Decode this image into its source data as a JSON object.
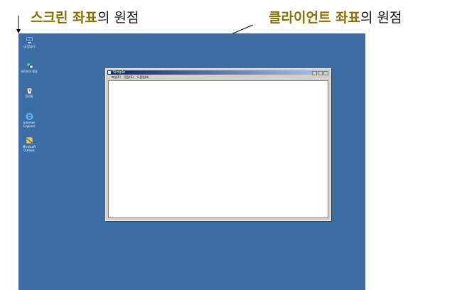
{
  "annotations": {
    "screen_origin": {
      "highlight": "스크린 좌표",
      "suffix": "의 원점"
    },
    "client_origin": {
      "highlight": "클라이언트 좌표",
      "suffix": "의 원점"
    }
  },
  "desktop": {
    "background_color": "#3a6ea5",
    "icons": [
      {
        "name": "computer-icon",
        "label": "내 컴퓨터"
      },
      {
        "name": "network-icon",
        "label": "네트워크 환경"
      },
      {
        "name": "recycle-bin-icon",
        "label": "휴지통"
      },
      {
        "name": "internet-explorer-icon",
        "label": "Internet Explorer"
      },
      {
        "name": "outlook-icon",
        "label": "Microsoft Outlook"
      }
    ]
  },
  "window": {
    "title": "Simple",
    "menu": [
      "파일(F)",
      "편집(E)",
      "도움말(H)"
    ],
    "title_gradient": [
      "#0a246a",
      "#a6caf0"
    ]
  }
}
